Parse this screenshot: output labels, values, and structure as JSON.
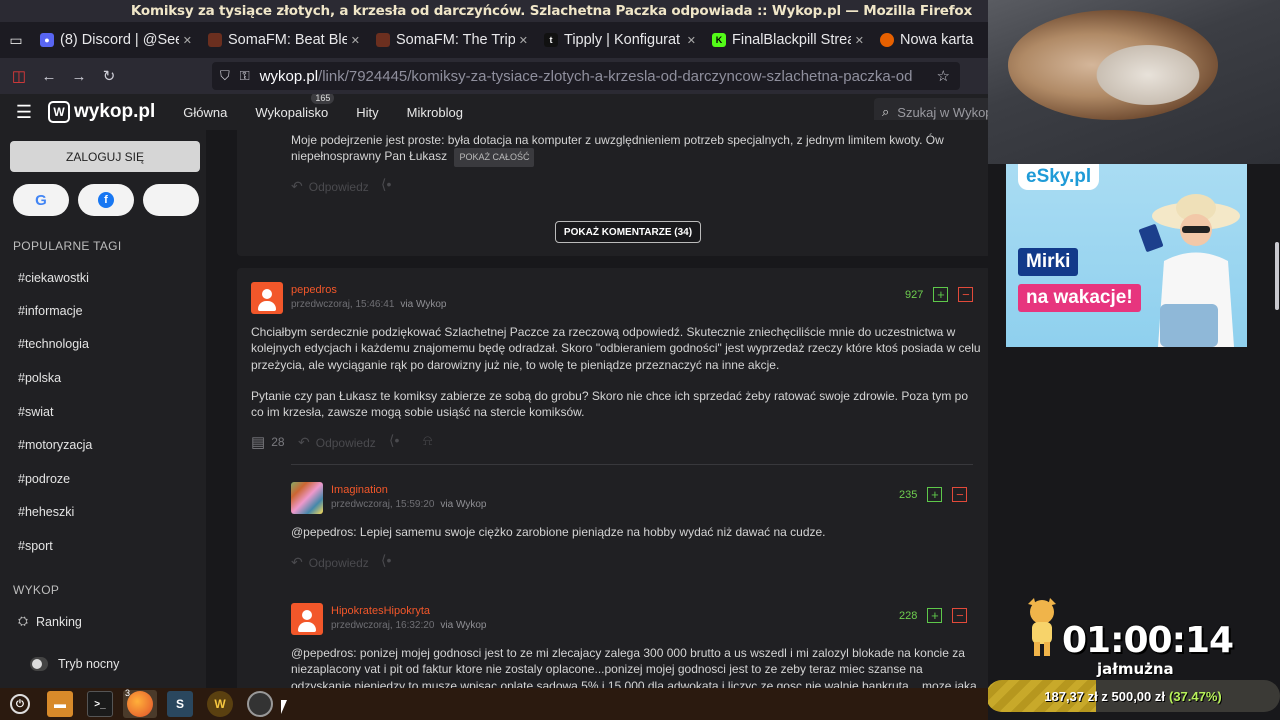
{
  "window": {
    "title": "Komiksy za tysiące złotych, a krzesła od darczyńców. Szlachetna Paczka odpowiada :: Wykop.pl — Mozilla Firefox"
  },
  "tabs": [
    {
      "label": "(8) Discord | @Seej",
      "icon": "discord-icon",
      "color": "#5865f2"
    },
    {
      "label": "SomaFM: Beat Blen",
      "icon": "somafm-icon",
      "color": "#6b2f1f"
    },
    {
      "label": "SomaFM: The Trip",
      "icon": "somafm-icon",
      "color": "#6b2f1f"
    },
    {
      "label": "Tipply | Konfigurat",
      "icon": "tipply-icon",
      "color": "#222222"
    },
    {
      "label": "FinalBlackpill Strea",
      "icon": "kick-icon",
      "color": "#53fc18"
    },
    {
      "label": "Nowa karta",
      "icon": "firefox-icon",
      "color": "#e66000"
    }
  ],
  "url": {
    "host": "wykop.pl",
    "path": "/link/7924445/komiksy-za-tysiace-zlotych-a-krzesla-od-darczyncow-szlachetna-paczka-od"
  },
  "wykop_nav": {
    "logo": "wykop.pl",
    "links": [
      "Główna",
      "Wykopalisko",
      "Hity",
      "Mikroblog"
    ],
    "wykopalisko_count": "165",
    "search_placeholder": "Szukaj w Wykop"
  },
  "sidebar": {
    "login": "ZALOGUJ SIĘ",
    "tags_header": "POPULARNE TAGI",
    "tags": [
      "#ciekawostki",
      "#informacje",
      "#technologia",
      "#polska",
      "#swiat",
      "#motoryzacja",
      "#podroze",
      "#heheszki",
      "#sport"
    ],
    "wykop_header": "WYKOP",
    "ranking": "Ranking",
    "night_mode": "Tryb nocny"
  },
  "top_comment": {
    "text": "Moje podejrzenie jest proste: była dotacja na komputer z uwzględnieniem potrzeb specjalnych, z jednym limitem kwoty. Ów niepełnosprawny Pan Łukasz",
    "show_all": "POKAŻ CAŁOŚĆ",
    "reply": "Odpowiedz",
    "more_comments": "POKAŻ KOMENTARZE (34)"
  },
  "comments": [
    {
      "user": "pepedros",
      "date": "przedwczoraj, 15:46:41",
      "via": "via Wykop",
      "votes": "927",
      "text1": "Chciałbym serdecznie podziękować Szlachetnej Paczce za rzeczową odpowiedź. Skutecznie zniechęciliście mnie do uczestnictwa w kolejnych edycjach i każdemu znajomemu będę odradzał. Skoro \"odbieraniem godności\" jest wyprzedaż rzeczy które ktoś posiada w celu przeżycia, ale wyciąganie rąk po darowizny już nie, to wolę te pieniądze przeznaczyć na inne akcje.",
      "text2": "Pytanie czy pan Łukasz te komiksy zabierze ze sobą do grobu? Skoro nie chce ich sprzedać żeby ratować swoje zdrowie. Poza tym po co im krzesła, zawsze mogą sobie usiąść na stercie komiksów.",
      "reply_count": "28",
      "reply": "Odpowiedz"
    },
    {
      "user": "Imagination",
      "date": "przedwczoraj, 15:59:20",
      "via": "via Wykop",
      "votes": "235",
      "text": "@pepedros: Lepiej samemu swoje ciężko zarobione pieniądze na hobby wydać niż dawać na cudze.",
      "reply": "Odpowiedz"
    },
    {
      "user": "HipokratesHipokryta",
      "date": "przedwczoraj, 16:32:20",
      "via": "via Wykop",
      "votes": "228",
      "text": "@pepedros: ponizej mojej godnosci jest to ze mi zlecajacy zalega 300 000 brutto a us wszedl i mi zalozyl blokade na koncie za niezaplacony vat i pit od faktur ktore nie zostaly oplacone...ponizej mojej godnosci jest to ze zeby teraz miec szanse na odzyskanie pieniedzy to musze wpisac oplate sadowa 5% i 15 000 dla adwokata i liczyc ze gosc nie walnie bankruta... moze jaka"
    }
  ],
  "ad": {
    "brand": "eSky.pl",
    "line1": "Mirki",
    "line2": "na wakacje!"
  },
  "stream": {
    "timer": "01:00:14",
    "timer_label": "jałmużna",
    "goal_current": "187,37 zł",
    "goal_sep": "z",
    "goal_target": "500,00 zł",
    "goal_pct": "(37.47%)",
    "goal_fraction": 0.3747
  },
  "taskbar": {
    "items": [
      "menu-icon",
      "files-icon",
      "terminal-icon",
      "firefox-icon",
      "steam-icon",
      "wow-icon",
      "obs-icon"
    ],
    "firefox_count": "3"
  }
}
